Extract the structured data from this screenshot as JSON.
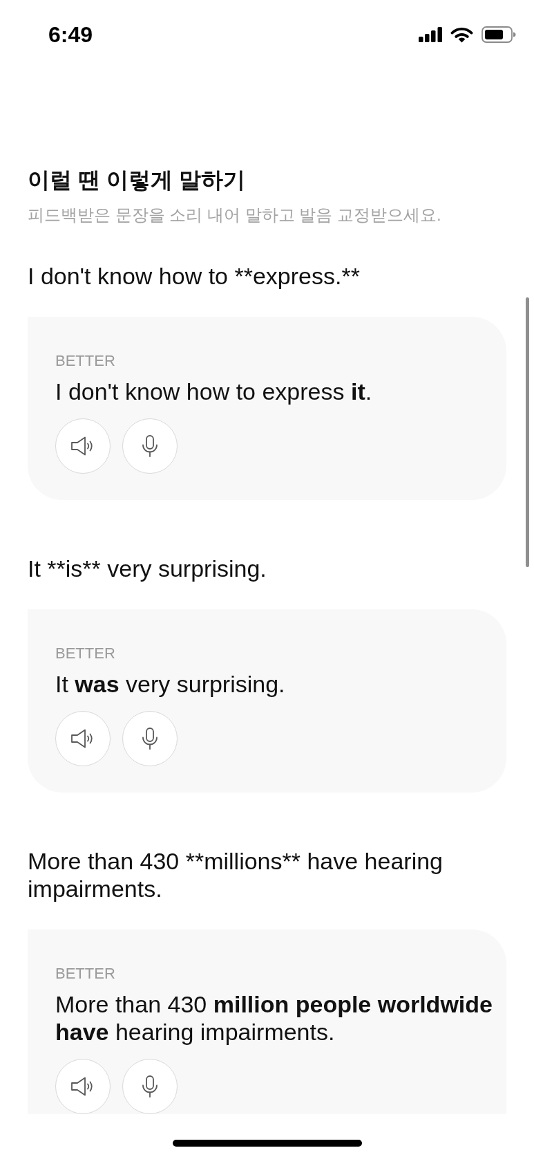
{
  "status_bar": {
    "time": "6:49"
  },
  "header": {
    "title": "이럴 땐 이렇게 말하기",
    "subtitle": "피드백받은 문장을 소리 내어 말하고 발음 교정받으세요."
  },
  "items": [
    {
      "original": "I don't know how to **express.**",
      "label": "BETTER",
      "better": "I don't know how to express **it**."
    },
    {
      "original": "It **is** very surprising.",
      "label": "BETTER",
      "better": "It **was** very surprising."
    },
    {
      "original": "More than 430 **millions** have hearing impairments.",
      "label": "BETTER",
      "better": "More than 430 **million people worldwide have** hearing impairments."
    }
  ]
}
